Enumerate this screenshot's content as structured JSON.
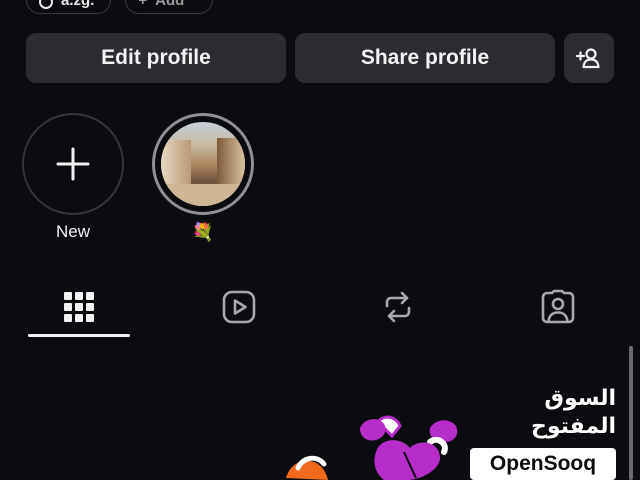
{
  "top_pills": [
    {
      "label": "a.zg."
    },
    {
      "label": "Add"
    }
  ],
  "actions": {
    "edit_label": "Edit profile",
    "share_label": "Share profile"
  },
  "highlights": {
    "new_label": "New",
    "items": [
      {
        "label": "💐"
      }
    ]
  },
  "tabs": [
    {
      "icon": "grid-icon",
      "active": true
    },
    {
      "icon": "reels-icon",
      "active": false
    },
    {
      "icon": "reposts-icon",
      "active": false
    },
    {
      "icon": "tagged-icon",
      "active": false
    }
  ],
  "watermark": {
    "arabic": "السوق المفتوح",
    "latin": "OpenSooq"
  },
  "colors": {
    "background": "#0b0c10",
    "button": "#2a2c31",
    "sticker_purple": "#b62dc9",
    "sticker_orange": "#f06a1e"
  }
}
